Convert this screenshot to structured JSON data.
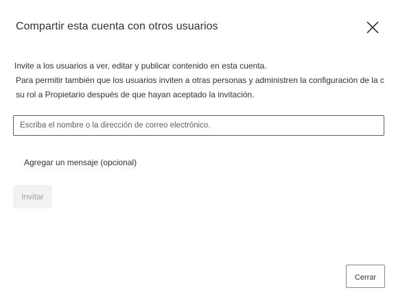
{
  "dialog": {
    "title": "Compartir esta cuenta con otros usuarios",
    "close_icon": "close-icon",
    "description": {
      "line1": "Invite a los usuarios a ver, editar y publicar contenido en esta cuenta.",
      "line2": "Para permitir también que los usuarios inviten a otras personas y administren la configuración de la c",
      "line3": "su rol a Propietario después de que hayan aceptado la invitación."
    },
    "email_input": {
      "value": "",
      "placeholder": "Escriba el nombre o la dirección de correo electrónico."
    },
    "add_message_label": "Agregar un mensaje (opcional)",
    "invite_button_label": "Invitar",
    "close_button_label": "Cerrar"
  }
}
